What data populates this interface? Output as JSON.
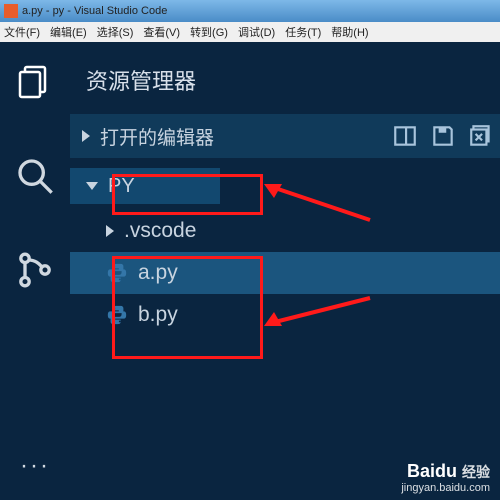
{
  "window": {
    "title": "a.py - py - Visual Studio Code"
  },
  "menu": {
    "file": "文件(F)",
    "edit": "编辑(E)",
    "select": "选择(S)",
    "view": "查看(V)",
    "goto": "转到(G)",
    "debug": "调试(D)",
    "tasks": "任务(T)",
    "help": "帮助(H)"
  },
  "activity": {
    "explorer": "explorer",
    "search": "search",
    "scm": "source-control",
    "more": "···"
  },
  "sidebar": {
    "title": "资源管理器",
    "open_editors": "打开的编辑器",
    "folder_name": "PY",
    "tree": {
      "vscode": ".vscode",
      "a": "a.py",
      "b": "b.py"
    }
  },
  "watermark": {
    "brand": "Baidu 经验",
    "url": "jingyan.baidu.com"
  }
}
